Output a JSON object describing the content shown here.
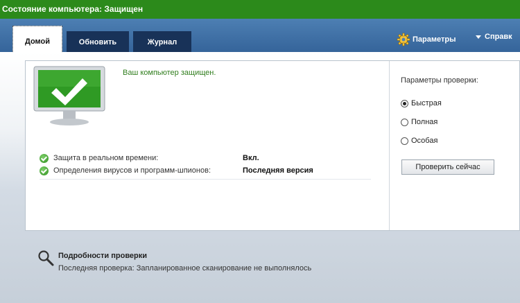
{
  "window": {
    "title": "Состояние компьютера: Защищен"
  },
  "tabs": [
    {
      "label": "Домой",
      "active": true
    },
    {
      "label": "Обновить",
      "active": false
    },
    {
      "label": "Журнал",
      "active": false
    }
  ],
  "header_buttons": {
    "settings": {
      "label": "Параметры",
      "icon": "gear-icon"
    },
    "help": {
      "label": "Справк",
      "icon": "caret-down-icon"
    }
  },
  "status": {
    "message": "Ваш компьютер защищен.",
    "icon": "monitor-check-icon",
    "rows": [
      {
        "label": "Защита в реальном времени:",
        "value": "Вкл.",
        "icon": "green-check-icon"
      },
      {
        "label": "Определения вирусов и программ-шпионов:",
        "value": "Последняя версия",
        "icon": "green-check-icon"
      }
    ]
  },
  "scan_options": {
    "title": "Параметры проверки:",
    "options": [
      {
        "label": "Быстрая",
        "selected": true
      },
      {
        "label": "Полная",
        "selected": false
      },
      {
        "label": "Особая",
        "selected": false
      }
    ],
    "button_label": "Проверить сейчас"
  },
  "details": {
    "title": "Подробности проверки",
    "last_scan": "Последняя проверка: Запланированное сканирование не выполнялось",
    "icon": "search-icon"
  },
  "colors": {
    "titlebar": "#2c8a1b",
    "header": "#4d7fb3",
    "tab_inactive": "#183258",
    "status_text": "#2f7d1c"
  }
}
